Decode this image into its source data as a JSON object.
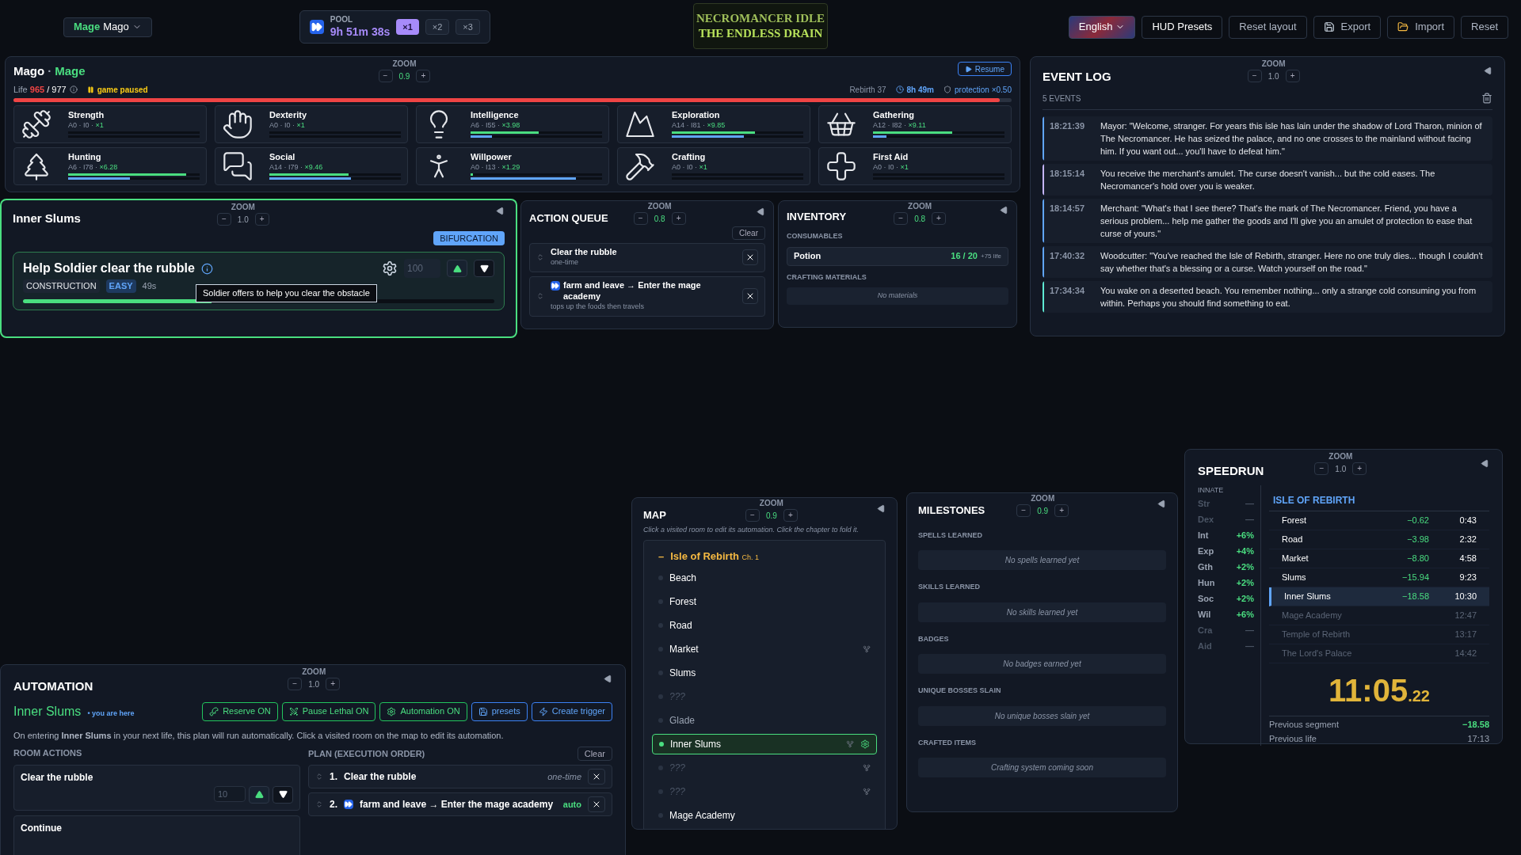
{
  "top_bar": {
    "character": {
      "class": "Mage",
      "name": "Mago"
    },
    "pool": {
      "label": "POOL",
      "time": "9h 51m 38s",
      "speeds": [
        {
          "label": "×1",
          "selected": true
        },
        {
          "label": "×2",
          "selected": false
        },
        {
          "label": "×3",
          "selected": false
        }
      ]
    },
    "logo": {
      "line1": "NECROMANCER IDLE",
      "line2": "THE ENDLESS DRAIN"
    },
    "language": "English",
    "buttons": [
      {
        "label": "HUD Presets",
        "kind": "plain"
      },
      {
        "label": "Reset layout",
        "kind": "plain"
      },
      {
        "label": "Export",
        "kind": "export"
      },
      {
        "label": "Import",
        "kind": "import"
      },
      {
        "label": "Reset",
        "kind": "plain"
      }
    ]
  },
  "character": {
    "name": "Mago",
    "separator": "·",
    "class": "Mage",
    "zoom": {
      "label": "ZOOM",
      "minus": "−",
      "value": "0.9",
      "plus": "+",
      "modified": true
    },
    "resume": "Resume",
    "life": {
      "label": "Life",
      "current": "965",
      "max": "/ 977",
      "level": 0.988
    },
    "status": "game paused",
    "rebirth": "Rebirth 37",
    "time": "8h 49m",
    "protection": "protection ×0.50",
    "stats": [
      {
        "name": "Strength",
        "meta": "A0 · I0 ·",
        "multiplier": "×1",
        "bars": [
          {
            "kind": "progress",
            "level": 0
          },
          {
            "kind": "experience",
            "level": 0
          }
        ]
      },
      {
        "name": "Dexterity",
        "meta": "A0 · I0 ·",
        "multiplier": "×1",
        "bars": [
          {
            "kind": "progress",
            "level": 0
          },
          {
            "kind": "experience",
            "level": 0
          }
        ]
      },
      {
        "name": "Intelligence",
        "meta": "A6 · I55 ·",
        "multiplier": "×3.98",
        "bars": [
          {
            "kind": "progress",
            "level": 0.52
          },
          {
            "kind": "experience",
            "level": 0.16
          }
        ]
      },
      {
        "name": "Exploration",
        "meta": "A14 · I81 ·",
        "multiplier": "×9.85",
        "bars": [
          {
            "kind": "progress",
            "level": 0.63
          },
          {
            "kind": "experience",
            "level": 0.55
          }
        ]
      },
      {
        "name": "Gathering",
        "meta": "A12 · I82 ·",
        "multiplier": "×9.11",
        "bars": [
          {
            "kind": "progress",
            "level": 0.6
          },
          {
            "kind": "experience",
            "level": 0.1
          }
        ]
      },
      {
        "name": "Hunting",
        "meta": "A6 · I78 ·",
        "multiplier": "×6.28",
        "bars": [
          {
            "kind": "progress",
            "level": 0.9
          },
          {
            "kind": "experience",
            "level": 0.47
          }
        ]
      },
      {
        "name": "Social",
        "meta": "A14 · I79 ·",
        "multiplier": "×9.46",
        "bars": [
          {
            "kind": "progress",
            "level": 0.6
          },
          {
            "kind": "experience",
            "level": 0.62
          }
        ]
      },
      {
        "name": "Willpower",
        "meta": "A0 · I13 ·",
        "multiplier": "×1.29",
        "bars": [
          {
            "kind": "progress",
            "level": 0.02
          },
          {
            "kind": "experience",
            "level": 0.8
          }
        ]
      },
      {
        "name": "Crafting",
        "meta": "A0 · I0 ·",
        "multiplier": "×1",
        "bars": [
          {
            "kind": "progress",
            "level": 0
          },
          {
            "kind": "experience",
            "level": 0
          }
        ]
      },
      {
        "name": "First Aid",
        "meta": "A0 · I0 ·",
        "multiplier": "×1",
        "bars": [
          {
            "kind": "progress",
            "level": 0
          },
          {
            "kind": "experience",
            "level": 0
          }
        ]
      }
    ]
  },
  "room": {
    "title": "Inner Slums",
    "zoom": {
      "label": "ZOOM",
      "minus": "−",
      "value": "1.0",
      "plus": "+",
      "modified": false
    },
    "badge": "BIFURCATION",
    "action": {
      "title": "Help Soldier clear the rubble",
      "tags": [
        "CONSTRUCTION",
        "EASY"
      ],
      "duration": "49s",
      "placeholder": "100",
      "tooltip": "Soldier offers to help you clear the obstacle",
      "level": 0.4
    }
  },
  "action_queue": {
    "title": "ACTION QUEUE",
    "zoom": {
      "label": "ZOOM",
      "minus": "−",
      "value": "0.8",
      "plus": "+",
      "modified": true
    },
    "clear": "Clear",
    "items": [
      {
        "kind": "action",
        "title": "Clear the rubble",
        "subtitle": "one-time"
      },
      {
        "kind": "automation",
        "title": "farm and leave → Enter the mage academy",
        "subtitle": "tops up the foods then travels"
      }
    ]
  },
  "inventory": {
    "title": "INVENTORY",
    "zoom": {
      "label": "ZOOM",
      "minus": "−",
      "value": "0.8",
      "plus": "+",
      "modified": true
    },
    "sections": [
      {
        "title": "CONSUMABLES",
        "items": [
          {
            "name": "Potion",
            "count": "16 / 20",
            "effect": "+75 life"
          }
        ]
      },
      {
        "title": "CRAFTING MATERIALS",
        "empty": "No materials"
      }
    ]
  },
  "event_log": {
    "title": "EVENT LOG",
    "zoom": {
      "label": "ZOOM",
      "minus": "−",
      "value": "1.0",
      "plus": "+",
      "modified": false
    },
    "count": "5 EVENTS",
    "events": [
      {
        "time": "18:21:39",
        "color": "#60a5fa",
        "text": "Mayor: \"Welcome, stranger. For years this isle has lain under the shadow of Lord Tharon, minion of The Necromancer. He has seized the palace, and no one crosses to the mainland without facing him. If you want out... you'll have to defeat him.\""
      },
      {
        "time": "18:15:14",
        "color": "#c4b5fd",
        "text": "You receive the merchant's amulet. The curse doesn't vanish... but the cold eases. The Necromancer's hold over you is weaker."
      },
      {
        "time": "18:14:57",
        "color": "#60a5fa",
        "text": "Merchant: \"What's that I see there? That's the mark of The Necromancer. Friend, you have a serious problem... help me gather the goods and I'll give you an amulet of protection to ease that curse of yours.\""
      },
      {
        "time": "17:40:32",
        "color": "#60a5fa",
        "text": "Woodcutter: \"You've reached the Isle of Rebirth, stranger. Here no one truly dies... though I couldn't say whether that's a blessing or a curse. Watch yourself on the road.\""
      },
      {
        "time": "17:34:34",
        "color": "#5eead4",
        "text": "You wake on a deserted beach. You remember nothing... only a strange cold consuming you from within. Perhaps you should find something to eat."
      }
    ]
  },
  "automation": {
    "title": "AUTOMATION",
    "zoom": {
      "label": "ZOOM",
      "minus": "−",
      "value": "1.0",
      "plus": "+",
      "modified": false
    },
    "room": "Inner Slums",
    "here": "• you are here",
    "buttons": [
      {
        "label": "Reserve ON",
        "kind": "toggle"
      },
      {
        "label": "Pause Lethal ON",
        "kind": "toggle"
      },
      {
        "label": "Automation ON",
        "kind": "toggle"
      },
      {
        "label": "presets",
        "kind": "action"
      },
      {
        "label": "Create trigger",
        "kind": "action"
      }
    ],
    "description": "On entering **Inner Slums** in your next life, this plan will run automatically. Click a visited room on the map to edit its automation.",
    "room_actions": {
      "title": "ROOM ACTIONS",
      "items": [
        {
          "name": "Clear the rubble",
          "placeholder": "10"
        },
        {
          "name": "Continue"
        }
      ]
    },
    "plan": {
      "title": "PLAN (EXECUTION ORDER)",
      "clear": "Clear",
      "items": [
        {
          "kind": "action",
          "index": "1.",
          "title": "Clear the rubble",
          "tag": "one-time"
        },
        {
          "kind": "automation",
          "index": "2.",
          "title": "farm and leave → Enter the mage academy",
          "tag": "auto"
        }
      ]
    }
  },
  "map": {
    "title": "MAP",
    "zoom": {
      "label": "ZOOM",
      "minus": "−",
      "value": "0.9",
      "plus": "+",
      "modified": true
    },
    "hint": "Click a visited room to edit its automation. Click the chapter to fold it.",
    "chapter": {
      "toggle": "–",
      "name": "Isle of Rebirth",
      "number": "Ch. 1",
      "expanded": true,
      "rooms": [
        {
          "kind": "room",
          "name": "Beach",
          "visited": true,
          "fork": false,
          "selected": false,
          "current": false,
          "automated": false
        },
        {
          "kind": "room",
          "name": "Forest",
          "visited": true,
          "fork": false,
          "selected": false,
          "current": false,
          "automated": false
        },
        {
          "kind": "room",
          "name": "Road",
          "visited": true,
          "fork": false,
          "selected": false,
          "current": false,
          "automated": false
        },
        {
          "kind": "room",
          "name": "Market",
          "visited": true,
          "fork": true,
          "selected": false,
          "current": false,
          "automated": false
        },
        {
          "kind": "room",
          "name": "Slums",
          "visited": true,
          "fork": false,
          "selected": false,
          "current": false,
          "automated": false
        },
        {
          "kind": "unknown",
          "name": "???",
          "visited": false,
          "fork": false,
          "selected": false,
          "current": false,
          "automated": false
        },
        {
          "kind": "room",
          "name": "Glade",
          "visited": false,
          "fork": false,
          "selected": false,
          "current": false,
          "automated": false
        },
        {
          "kind": "room",
          "name": "Inner Slums",
          "visited": true,
          "fork": true,
          "selected": true,
          "current": true,
          "automated": true
        },
        {
          "kind": "unknown",
          "name": "???",
          "visited": false,
          "fork": true,
          "selected": false,
          "current": false,
          "automated": false
        },
        {
          "kind": "unknown",
          "name": "???",
          "visited": false,
          "fork": true,
          "selected": false,
          "current": false,
          "automated": false
        },
        {
          "kind": "room",
          "name": "Mage Academy",
          "visited": true,
          "fork": false,
          "selected": false,
          "current": false,
          "automated": false
        }
      ]
    }
  },
  "milestones": {
    "title": "MILESTONES",
    "zoom": {
      "label": "ZOOM",
      "minus": "−",
      "value": "0.9",
      "plus": "+",
      "modified": true
    },
    "sections": [
      {
        "title": "SPELLS LEARNED",
        "empty": "No spells learned yet"
      },
      {
        "title": "SKILLS LEARNED",
        "empty": "No skills learned yet"
      },
      {
        "title": "BADGES",
        "empty": "No badges earned yet"
      },
      {
        "title": "UNIQUE BOSSES SLAIN",
        "empty": "No unique bosses slain yet"
      },
      {
        "title": "CRAFTED ITEMS",
        "empty": "Crafting system coming soon"
      }
    ]
  },
  "speedrun": {
    "title": "SPEEDRUN",
    "zoom": {
      "label": "ZOOM",
      "minus": "−",
      "value": "1.0",
      "plus": "+",
      "modified": false
    },
    "innate_title": "INNATE",
    "innate": [
      {
        "abbr": "Str",
        "value": "—",
        "active": false
      },
      {
        "abbr": "Dex",
        "value": "—",
        "active": false
      },
      {
        "abbr": "Int",
        "value": "+6%",
        "active": true
      },
      {
        "abbr": "Exp",
        "value": "+4%",
        "active": true
      },
      {
        "abbr": "Gth",
        "value": "+2%",
        "active": true
      },
      {
        "abbr": "Hun",
        "value": "+2%",
        "active": true
      },
      {
        "abbr": "Soc",
        "value": "+2%",
        "active": true
      },
      {
        "abbr": "Wil",
        "value": "+6%",
        "active": true
      },
      {
        "abbr": "Cra",
        "value": "—",
        "active": false
      },
      {
        "abbr": "Aid",
        "value": "—",
        "active": false
      }
    ],
    "chapter": "ISLE OF REBIRTH",
    "splits": [
      {
        "name": "Forest",
        "delta": "−0.62",
        "time": "0:43",
        "reached": true,
        "selected": false
      },
      {
        "name": "Road",
        "delta": "−3.98",
        "time": "2:32",
        "reached": true,
        "selected": false
      },
      {
        "name": "Market",
        "delta": "−8.80",
        "time": "4:58",
        "reached": true,
        "selected": false
      },
      {
        "name": "Slums",
        "delta": "−15.94",
        "time": "9:23",
        "reached": true,
        "selected": false
      },
      {
        "name": "Inner Slums",
        "delta": "−18.58",
        "time": "10:30",
        "reached": true,
        "selected": true
      },
      {
        "name": "Mage Academy",
        "time": "12:47",
        "reached": false,
        "selected": false
      },
      {
        "name": "Temple of Rebirth",
        "time": "13:17",
        "reached": false,
        "selected": false
      },
      {
        "name": "The Lord's Palace",
        "time": "14:42",
        "reached": false,
        "selected": false
      }
    ],
    "timer": {
      "main": "11:05",
      "fraction": ".22"
    },
    "footer": [
      {
        "label": "Previous segment",
        "value": "−18.58",
        "kind": "delta"
      },
      {
        "label": "Previous life",
        "value": "17:13",
        "kind": "time"
      }
    ]
  }
}
